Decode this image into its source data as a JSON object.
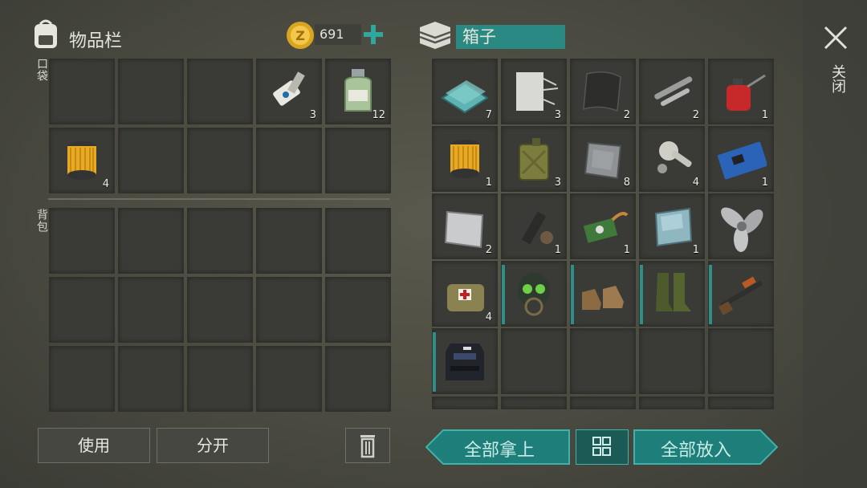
{
  "inventory": {
    "title": "物品栏",
    "coins": "691",
    "pocket_label": "口袋",
    "backpack_label": "背包",
    "pocket": [
      {
        "icon": "empty",
        "count": ""
      },
      {
        "icon": "empty",
        "count": ""
      },
      {
        "icon": "empty",
        "count": ""
      },
      {
        "icon": "key-card-icon",
        "count": "3"
      },
      {
        "icon": "bottle-icon",
        "count": "12"
      },
      {
        "icon": "filter-icon",
        "count": "4"
      },
      {
        "icon": "empty",
        "count": ""
      },
      {
        "icon": "empty",
        "count": ""
      },
      {
        "icon": "empty",
        "count": ""
      },
      {
        "icon": "empty",
        "count": ""
      }
    ]
  },
  "box": {
    "title": "箱子",
    "close_label": "关闭",
    "items": [
      {
        "name": "glass-pane-icon",
        "count": "7"
      },
      {
        "name": "fabric-icon",
        "count": "3"
      },
      {
        "name": "rubber-sheet-icon",
        "count": "2"
      },
      {
        "name": "pipes-icon",
        "count": "2"
      },
      {
        "name": "oil-can-icon",
        "count": "1"
      },
      {
        "name": "filter-icon",
        "count": "1"
      },
      {
        "name": "jerrycan-icon",
        "count": "3"
      },
      {
        "name": "metal-plate-icon",
        "count": "8"
      },
      {
        "name": "engine-parts-icon",
        "count": "4"
      },
      {
        "name": "circuit-board-icon",
        "count": "1"
      },
      {
        "name": "steel-sheet-icon",
        "count": "2"
      },
      {
        "name": "gun-parts-icon",
        "count": "1"
      },
      {
        "name": "chip-icon",
        "count": "1"
      },
      {
        "name": "mirror-plate-icon",
        "count": "1"
      },
      {
        "name": "propeller-icon",
        "count": ""
      },
      {
        "name": "medkit-bag-icon",
        "count": "4"
      },
      {
        "name": "gas-mask-icon",
        "count": ""
      },
      {
        "name": "boots-icon",
        "count": ""
      },
      {
        "name": "rubber-boots-icon",
        "count": ""
      },
      {
        "name": "shotgun-icon",
        "count": ""
      },
      {
        "name": "vest-icon",
        "count": ""
      }
    ]
  },
  "buttons": {
    "use": "使用",
    "split": "分开",
    "take_all": "全部拿上",
    "put_all": "全部放入"
  },
  "colors": {
    "accent": "#1e7f7a",
    "slot": "#3a3b36",
    "bg": "#4f4f46"
  }
}
